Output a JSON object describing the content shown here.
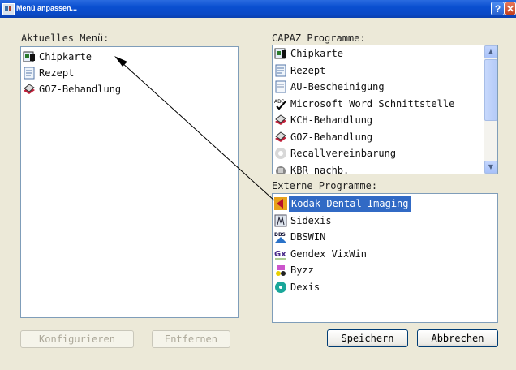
{
  "window": {
    "title": "Menü anpassen...",
    "help_glyph": "?",
    "close_glyph": "✕"
  },
  "current_menu": {
    "label": "Aktuelles Menü:",
    "items": [
      {
        "label": "Chipkarte",
        "icon": "chip-card-icon"
      },
      {
        "label": "Rezept",
        "icon": "prescription-icon"
      },
      {
        "label": "GOZ-Behandlung",
        "icon": "treatment-icon"
      }
    ]
  },
  "capaz_programs": {
    "label": "CAPAZ Programme:",
    "items": [
      {
        "label": "Chipkarte",
        "icon": "chip-card-icon"
      },
      {
        "label": "Rezept",
        "icon": "prescription-icon"
      },
      {
        "label": "AU-Bescheinigung",
        "icon": "certificate-icon"
      },
      {
        "label": "Microsoft Word Schnittstelle",
        "icon": "spellcheck-icon"
      },
      {
        "label": "KCH-Behandlung",
        "icon": "treatment-icon"
      },
      {
        "label": "GOZ-Behandlung",
        "icon": "treatment-icon"
      },
      {
        "label": "Recallvereinbarung",
        "icon": "recall-icon"
      },
      {
        "label": "KBR nachb.",
        "icon": "kbr-icon"
      }
    ],
    "scroll_up": "▲",
    "scroll_down": "▼"
  },
  "external_programs": {
    "label": "Externe Programme:",
    "items": [
      {
        "label": "Kodak Dental Imaging",
        "icon": "kodak-icon",
        "selected": true
      },
      {
        "label": "Sidexis",
        "icon": "sidexis-icon"
      },
      {
        "label": "DBSWIN",
        "icon": "dbswin-icon"
      },
      {
        "label": "Gendex VixWin",
        "icon": "gendex-icon"
      },
      {
        "label": "Byzz",
        "icon": "byzz-icon"
      },
      {
        "label": "Dexis",
        "icon": "dexis-icon"
      }
    ]
  },
  "buttons": {
    "configure": "Konfigurieren",
    "remove": "Entfernen",
    "save": "Speichern",
    "cancel": "Abbrechen"
  },
  "colors": {
    "selection": "#316ac5",
    "arrow": "#000000"
  }
}
